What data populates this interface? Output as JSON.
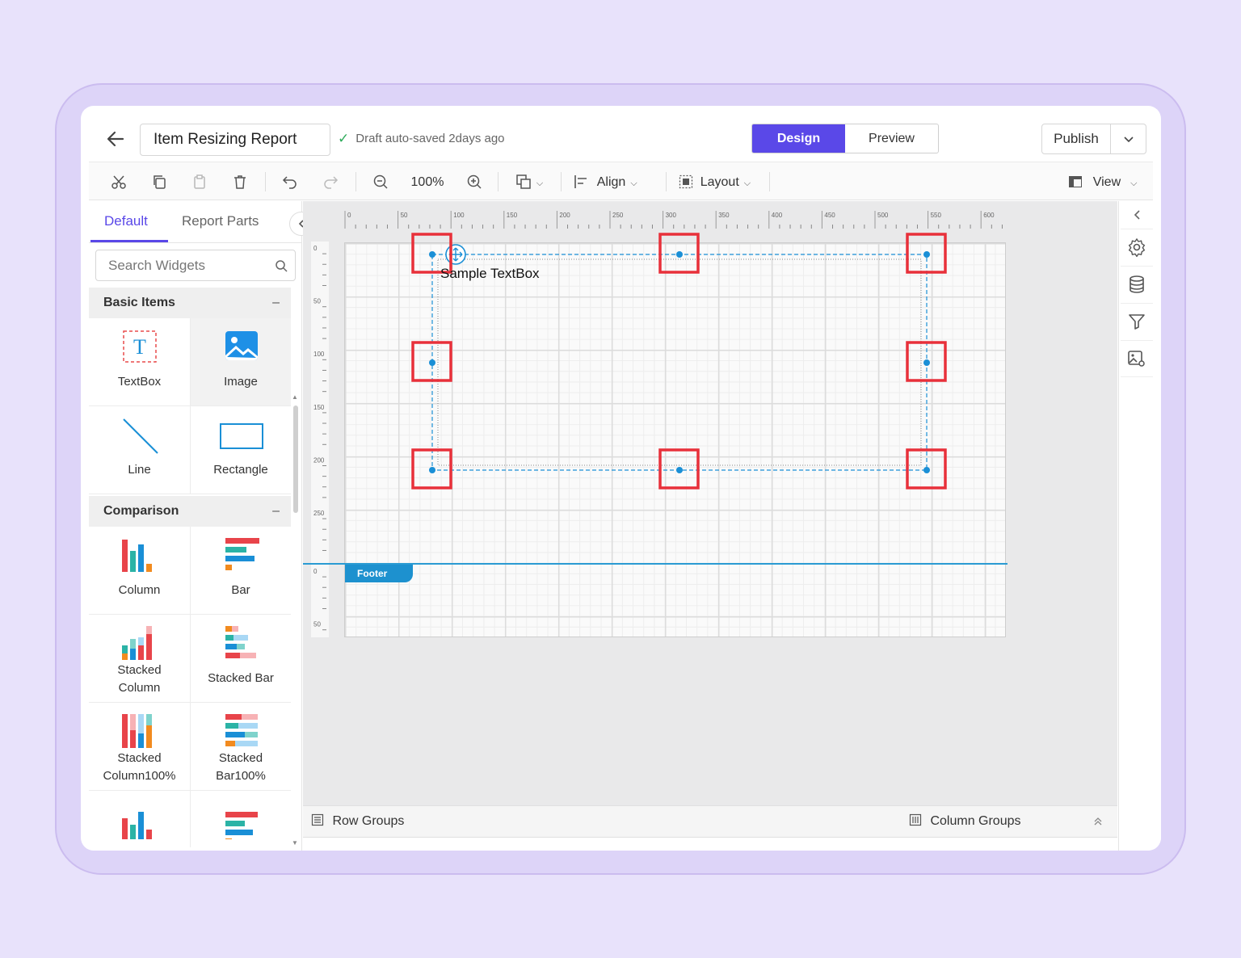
{
  "header": {
    "report_title": "Item Resizing Report",
    "save_status": "Draft auto-saved 2days ago",
    "mode_design": "Design",
    "mode_preview": "Preview",
    "publish_label": "Publish"
  },
  "toolbar": {
    "zoom_level": "100%",
    "align_label": "Align",
    "layout_label": "Layout",
    "view_label": "View"
  },
  "left_panel": {
    "tab_default": "Default",
    "tab_report_parts": "Report Parts",
    "search_placeholder": "Search Widgets",
    "categories": [
      {
        "name": "Basic Items",
        "items": [
          "TextBox",
          "Image",
          "Line",
          "Rectangle"
        ]
      },
      {
        "name": "Comparison",
        "items": [
          "Column",
          "Bar",
          "Stacked Column",
          "Stacked Bar",
          "Stacked Column100%",
          "Stacked Bar100%"
        ]
      }
    ],
    "collapse_symbol": "–"
  },
  "canvas": {
    "ruler_marks": [
      "0",
      "50",
      "100",
      "150",
      "200",
      "250",
      "300",
      "350",
      "400",
      "450",
      "500",
      "550",
      "600"
    ],
    "vruler_marks": [
      "0",
      "50",
      "100",
      "150",
      "200",
      "250"
    ],
    "footer_vruler_marks": [
      "0",
      "50"
    ],
    "textbox_text": "Sample TextBox",
    "footer_label": "Footer"
  },
  "bottom_bar": {
    "row_groups": "Row Groups",
    "column_groups": "Column Groups"
  },
  "colors": {
    "accent": "#5a48e8",
    "selection": "#1a8fd6",
    "highlight": "#e8303a"
  }
}
